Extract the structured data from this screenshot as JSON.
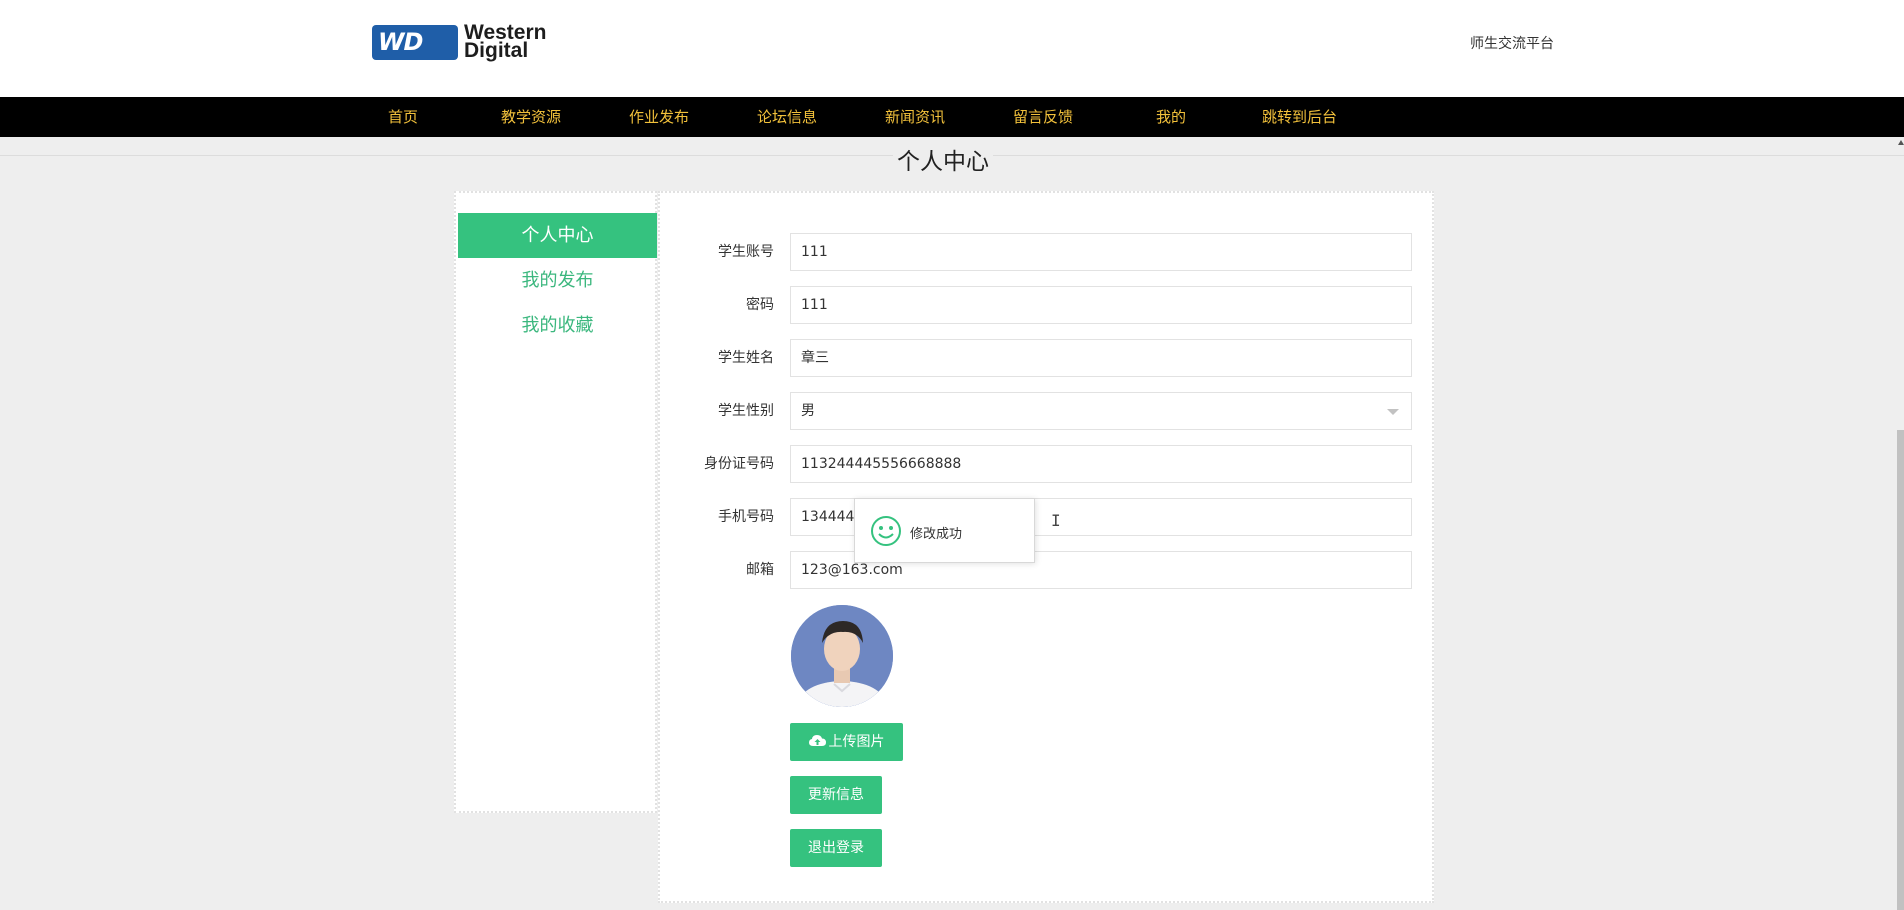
{
  "header": {
    "logo_line1": "Western",
    "logo_line2": "Digital",
    "logo_mark": "WD",
    "site_title": "师生交流平台"
  },
  "nav": {
    "items": [
      "首页",
      "教学资源",
      "作业发布",
      "论坛信息",
      "新闻资讯",
      "留言反馈",
      "我的",
      "跳转到后台"
    ],
    "color": "#f2c13b"
  },
  "page": {
    "title": "个人中心"
  },
  "sidebar": {
    "items": [
      {
        "label": "个人中心",
        "active": true
      },
      {
        "label": "我的发布",
        "active": false
      },
      {
        "label": "我的收藏",
        "active": false
      }
    ],
    "accent_color": "#35c27f"
  },
  "form": {
    "fields": [
      {
        "label": "学生账号",
        "value": "111"
      },
      {
        "label": "密码",
        "value": "111"
      },
      {
        "label": "学生姓名",
        "value": "章三"
      },
      {
        "label": "学生性别",
        "value": "男",
        "type": "select"
      },
      {
        "label": "身份证号码",
        "value": "113244445556668888"
      },
      {
        "label": "手机号码",
        "value": "1344444"
      },
      {
        "label": "邮箱",
        "value": "123@163.com"
      }
    ],
    "avatar_icon": "user-photo",
    "buttons": {
      "upload": "上传图片",
      "upload_icon": "cloud-upload-icon",
      "update": "更新信息",
      "logout": "退出登录"
    }
  },
  "toast": {
    "message": "修改成功",
    "icon": "smile-icon"
  }
}
